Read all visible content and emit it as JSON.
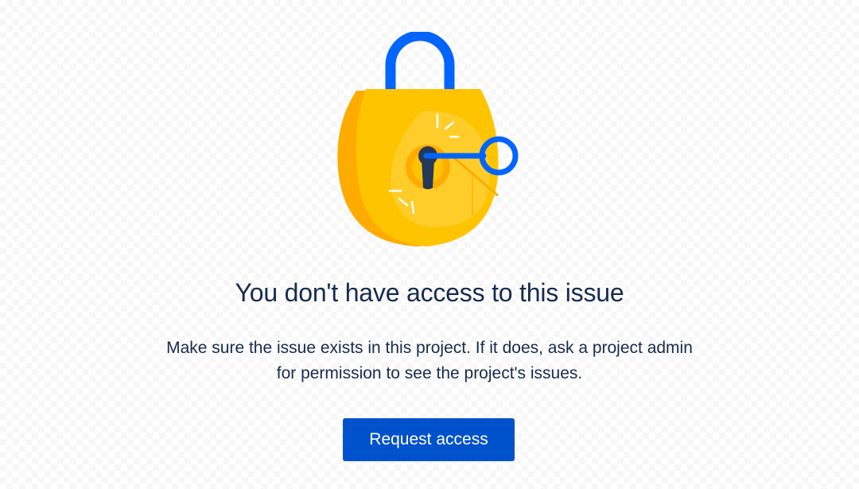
{
  "empty_state": {
    "title": "You don't have access to this issue",
    "description_line1": "Make sure the issue exists in this project. If it does, ask a project admin",
    "description_line2": "for permission to see the project's issues.",
    "action_button": "Request access",
    "illustration": "padlock-with-key-icon"
  },
  "colors": {
    "heading_text": "#172b4d",
    "button_bg": "#0052cc",
    "button_text": "#ffffff",
    "lock_body": "#ffc400",
    "lock_shade": "#ffab00",
    "shackle": "#0065ff",
    "keyhole": "#253858"
  }
}
